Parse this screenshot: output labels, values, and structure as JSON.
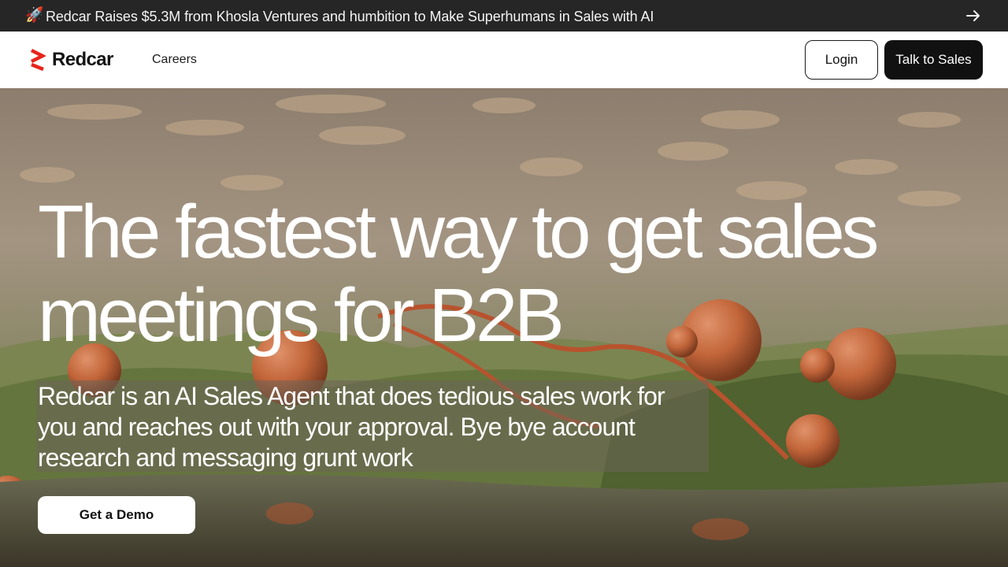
{
  "announcement": {
    "icon": "rocket-icon",
    "emoji": "🚀",
    "text": "Redcar Raises $5.3M from Khosla Ventures and humbition to Make Superhumans in Sales with AI",
    "arrow_icon": "arrow-right-icon"
  },
  "nav": {
    "brand": "Redcar",
    "brand_color": "#e8231a",
    "links": [
      "Careers"
    ],
    "login_label": "Login",
    "sales_label": "Talk to Sales"
  },
  "hero": {
    "headline": "The fastest way to get sales meetings for B2B",
    "subtext": "Redcar is an AI Sales Agent that does tedious sales work for you and reaches out with your approval. Bye bye account research and messaging grunt work",
    "cta_label": "Get a Demo"
  }
}
